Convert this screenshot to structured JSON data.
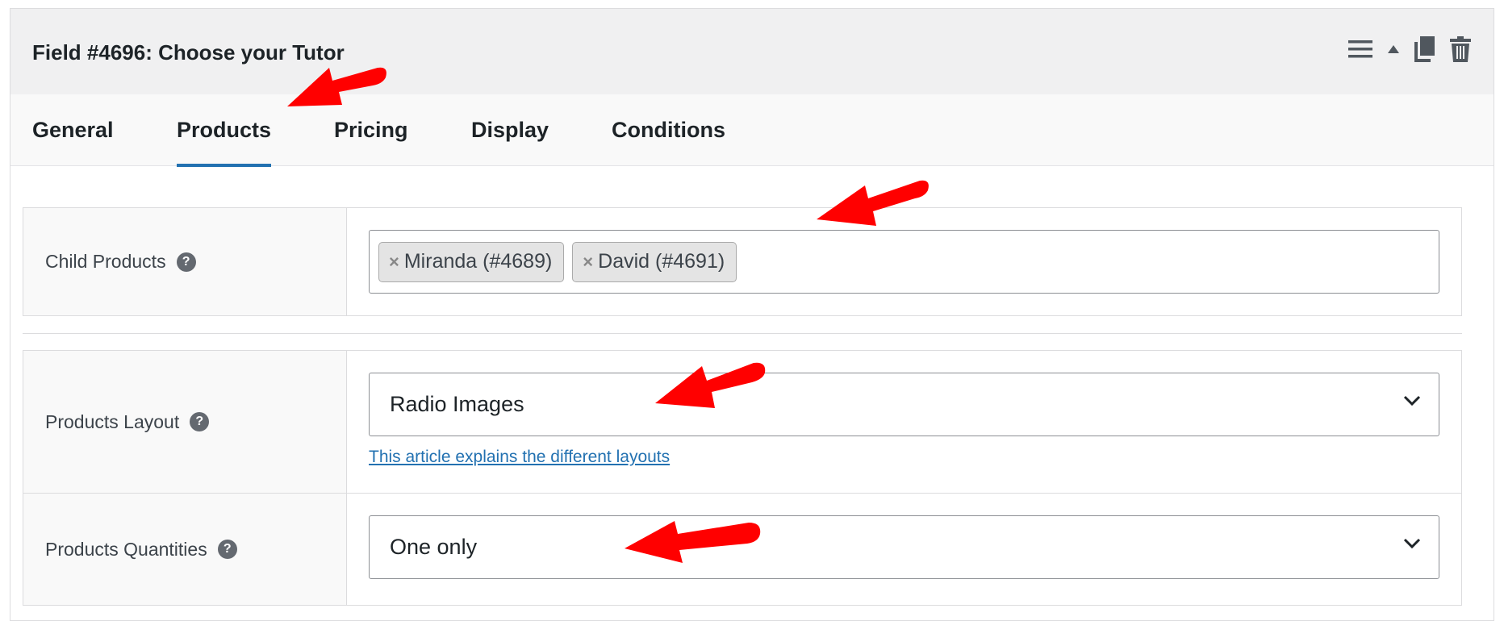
{
  "panel": {
    "title": "Field #4696: Choose your Tutor",
    "tools": [
      "menu-icon",
      "collapse-arrow-icon",
      "duplicate-icon",
      "trash-icon"
    ]
  },
  "tabs": [
    {
      "label": "General",
      "active": false
    },
    {
      "label": "Products",
      "active": true
    },
    {
      "label": "Pricing",
      "active": false
    },
    {
      "label": "Display",
      "active": false
    },
    {
      "label": "Conditions",
      "active": false
    }
  ],
  "fields": {
    "child_products": {
      "label": "Child Products",
      "tags": [
        {
          "remove": "×",
          "text": "Miranda (#4689)"
        },
        {
          "remove": "×",
          "text": "David (#4691)"
        }
      ]
    },
    "products_layout": {
      "label": "Products Layout",
      "value": "Radio Images",
      "link": "This article explains the different layouts"
    },
    "products_quantities": {
      "label": "Products Quantities",
      "value": "One only"
    }
  },
  "help_glyph": "?",
  "colors": {
    "accent": "#2271b1",
    "annotation_arrow": "#ff0000",
    "header_bg": "#f0f0f1"
  }
}
